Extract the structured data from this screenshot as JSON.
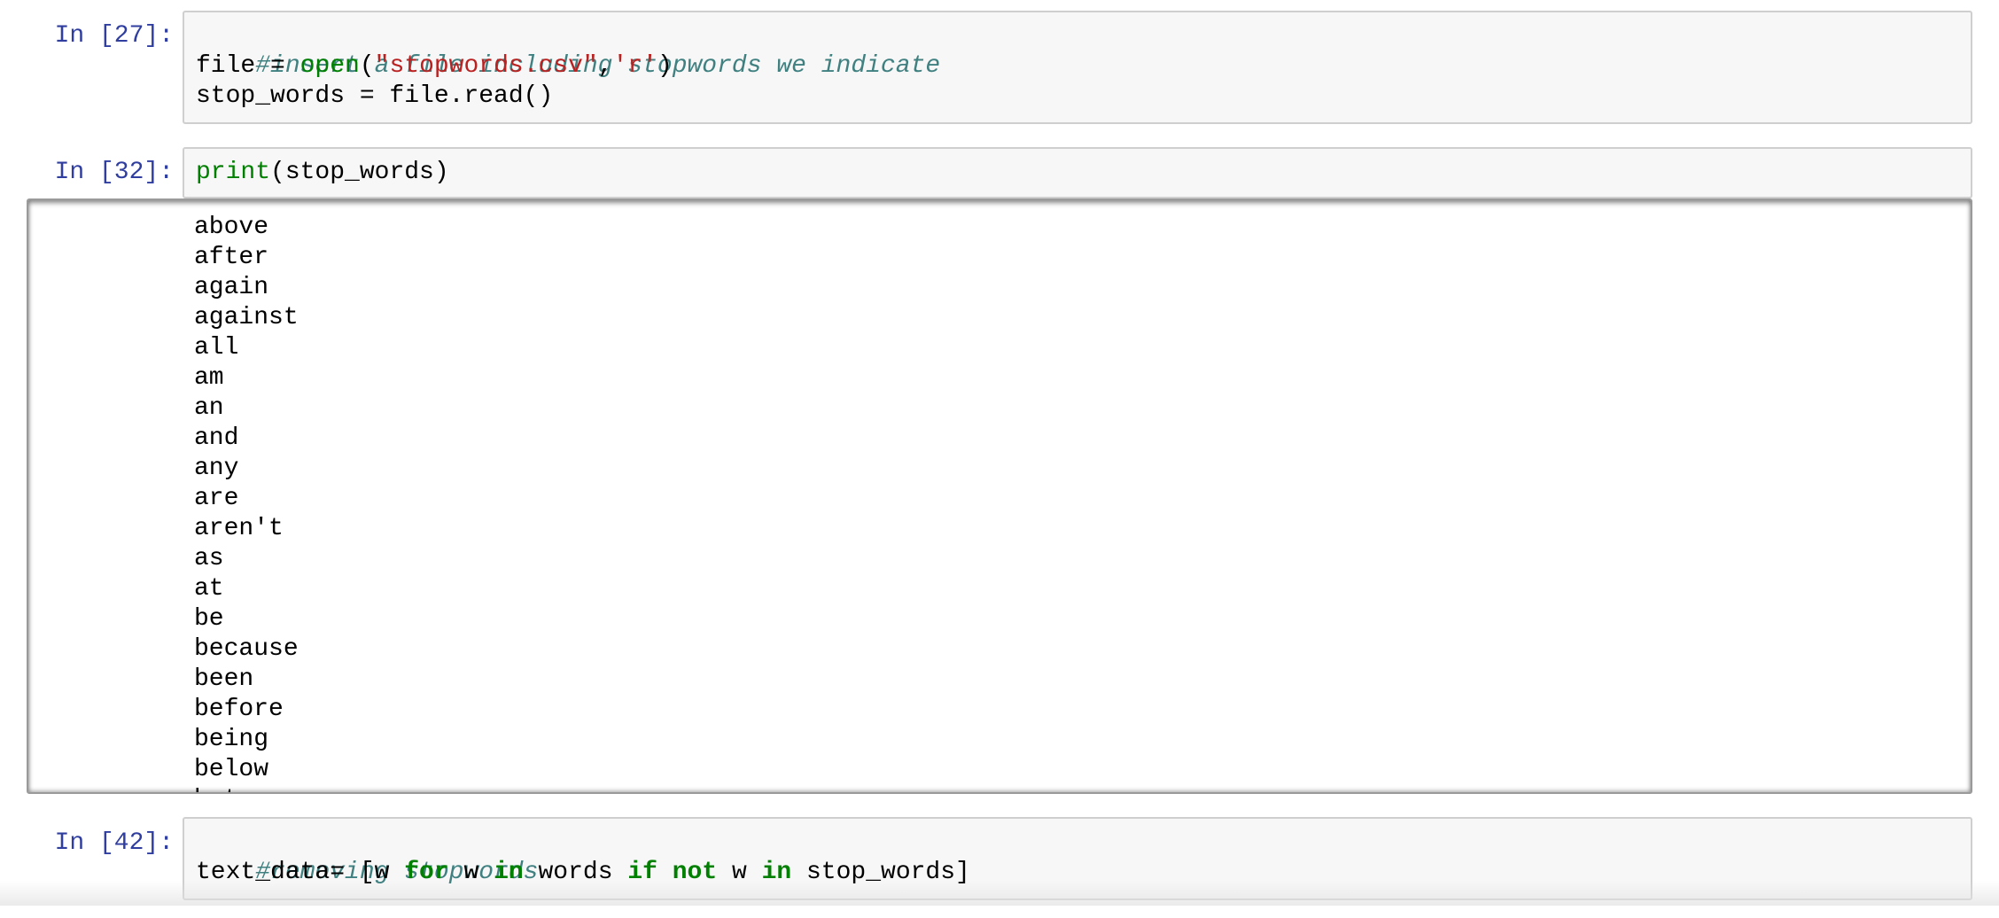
{
  "cells": {
    "cell27": {
      "prompt": "In [27]:",
      "line1": {
        "comment": "#insert a file including stopwords we indicate"
      },
      "line2": {
        "t1": "file = ",
        "builtin": "open",
        "t2": "(",
        "str1": "\"stopwords.csv\"",
        "t3": ",",
        "str2": "'r'",
        "t4": ")"
      },
      "line3": {
        "t1": "stop_words = file.read()"
      }
    },
    "cell32": {
      "prompt": "In [32]:",
      "line1": {
        "builtin": "print",
        "t1": "(stop_words)"
      },
      "output": [
        "above",
        "after",
        "again",
        "against",
        "all",
        "am",
        "an",
        "and",
        "any",
        "are",
        "aren't",
        "as",
        "at",
        "be",
        "because",
        "been",
        "before",
        "being",
        "below",
        "between"
      ]
    },
    "cell42": {
      "prompt": "In [42]:",
      "line1": {
        "comment": "#removing stopwords"
      },
      "line2": {
        "t1": "text_data= [w ",
        "kw1": "for",
        "t2": " w ",
        "kw2": "in",
        "t3": " words ",
        "kw3": "if",
        "t4": " ",
        "kw4": "not",
        "t5": " w ",
        "kw5": "in",
        "t6": " stop_words]"
      }
    }
  },
  "colors": {
    "prompt": "#303f9f",
    "comment": "#408080",
    "builtin": "#008000",
    "string": "#ba2121",
    "keyword": "#008000",
    "input_bg": "#f7f7f7"
  }
}
